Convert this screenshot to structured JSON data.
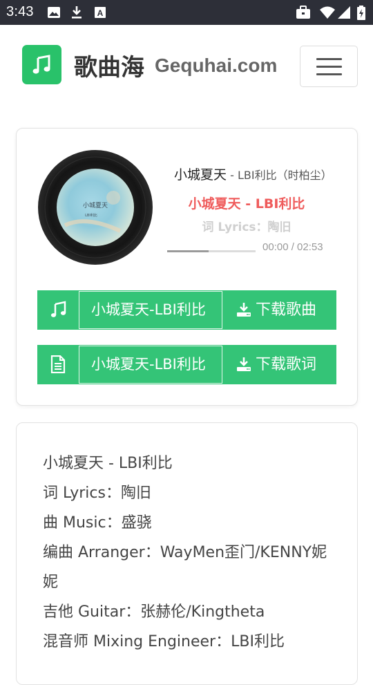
{
  "status_bar": {
    "time": "3:43",
    "left_icons": [
      "image-icon",
      "download-icon",
      "font-icon"
    ],
    "right_icons": [
      "briefcase-icon",
      "wifi-icon",
      "signal-icon",
      "battery-icon"
    ]
  },
  "header": {
    "logo_icon": "music-note-icon",
    "brand_cn": "歌曲海",
    "brand_en": "Gequhai.com",
    "menu_icon": "hamburger-menu-icon"
  },
  "player": {
    "song_title": "小城夏天",
    "song_artist": " - LBI利比（时柏尘）",
    "current_lyric": "小城夏天 - LBI利比",
    "next_lyric": "词 Lyrics：陶旧",
    "time_display": "00:00 / 02:53",
    "progress_fraction": 0.47,
    "cover_title": "小城夏天",
    "cover_subtitle": "LBI利比",
    "downloads": [
      {
        "icon": "music-note-icon",
        "name": "小城夏天-LBI利比",
        "button": "下载歌曲"
      },
      {
        "icon": "file-text-icon",
        "name": "小城夏天-LBI利比",
        "button": "下载歌词"
      }
    ]
  },
  "info": {
    "lines": [
      "小城夏天 - LBI利比",
      "词 Lyrics：陶旧",
      "曲 Music：盛骁",
      "编曲 Arranger：WayMen歪门/KENNY妮妮",
      "吉他 Guitar：张赫伦/Kingtheta",
      "混音师 Mixing Engineer：LBI利比"
    ]
  },
  "colors": {
    "accent_green": "#34c477",
    "logo_green": "#29c26a",
    "lyric_red": "#ef5b5b",
    "status_bar": "#2d2f38"
  }
}
